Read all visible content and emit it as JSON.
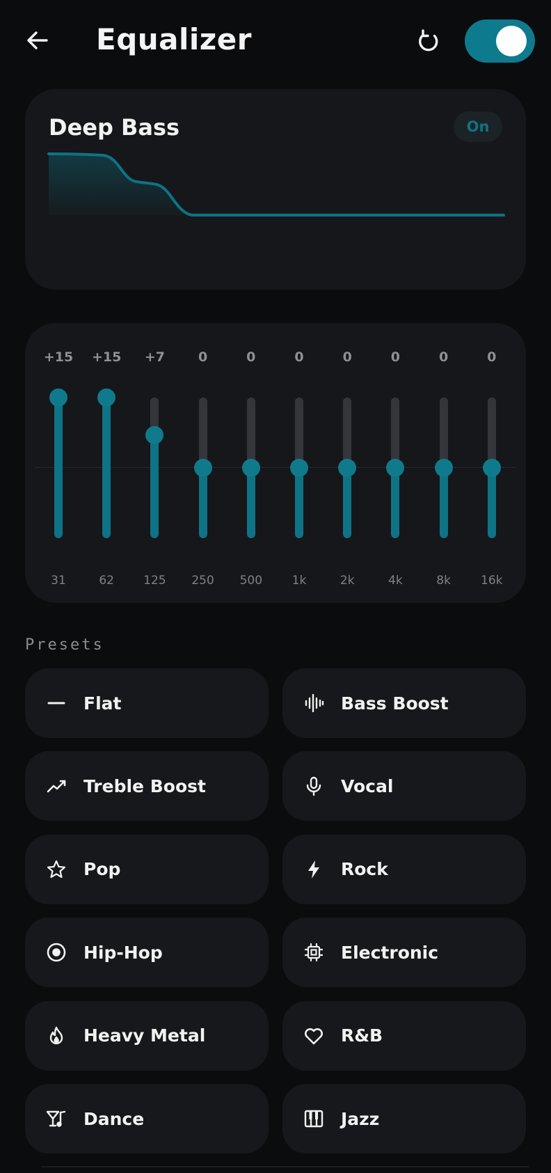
{
  "header": {
    "title": "Equalizer",
    "back_icon": "arrow-left-icon",
    "reset_icon": "refresh-icon",
    "master_toggle_on": true
  },
  "curve_card": {
    "preset_name": "Deep Bass",
    "status_badge": "On"
  },
  "bands": [
    {
      "gain": "+15",
      "freq": "31",
      "value": 15
    },
    {
      "gain": "+15",
      "freq": "62",
      "value": 15
    },
    {
      "gain": "+7",
      "freq": "125",
      "value": 7
    },
    {
      "gain": "0",
      "freq": "250",
      "value": 0
    },
    {
      "gain": "0",
      "freq": "500",
      "value": 0
    },
    {
      "gain": "0",
      "freq": "1k",
      "value": 0
    },
    {
      "gain": "0",
      "freq": "2k",
      "value": 0
    },
    {
      "gain": "0",
      "freq": "4k",
      "value": 0
    },
    {
      "gain": "0",
      "freq": "8k",
      "value": 0
    },
    {
      "gain": "0",
      "freq": "16k",
      "value": 0
    }
  ],
  "presets_section": {
    "label": "Presets",
    "items": [
      {
        "label": "Flat",
        "icon": "dash-icon"
      },
      {
        "label": "Bass Boost",
        "icon": "waveform-icon"
      },
      {
        "label": "Treble Boost",
        "icon": "trending-up-icon"
      },
      {
        "label": "Vocal",
        "icon": "microphone-icon"
      },
      {
        "label": "Pop",
        "icon": "star-icon"
      },
      {
        "label": "Rock",
        "icon": "lightning-icon"
      },
      {
        "label": "Hip-Hop",
        "icon": "vinyl-icon"
      },
      {
        "label": "Electronic",
        "icon": "chip-icon"
      },
      {
        "label": "Heavy Metal",
        "icon": "flame-icon"
      },
      {
        "label": "R&B",
        "icon": "heart-icon"
      },
      {
        "label": "Dance",
        "icon": "cocktail-music-icon"
      },
      {
        "label": "Jazz",
        "icon": "piano-icon"
      }
    ]
  },
  "colors": {
    "accent": "#0e7385",
    "background": "#0b0c0e",
    "card": "#16171a"
  }
}
